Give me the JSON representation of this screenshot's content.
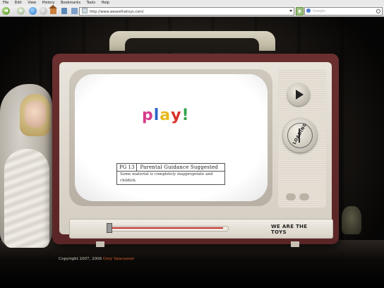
{
  "browser": {
    "menu": [
      "File",
      "Edit",
      "View",
      "History",
      "Bookmarks",
      "Tools",
      "Help"
    ],
    "url": "http://www.wearethetoys.com/",
    "search_placeholder": "Google",
    "icons": [
      "back-icon",
      "forward-icon",
      "reload-icon",
      "stop-icon",
      "home-icon"
    ]
  },
  "tv": {
    "play_letters": [
      "p",
      "l",
      "a",
      "y",
      "!"
    ],
    "play_colors": [
      "#d83b8a",
      "#2e63c9",
      "#e6b81e",
      "#d93027",
      "#2fa24a"
    ],
    "rating": {
      "code": "PG 13",
      "label": "Parental Guidance Suggested",
      "note": "Some material is completely inappropriate and childish."
    },
    "dial_label": "LOADING",
    "brand": "WE ARE THE TOYS"
  },
  "footer": {
    "copyright": "Copyright 2007, 2008",
    "author": "Grey Vancouver"
  },
  "colors": {
    "tv_body": "#6a2f2e",
    "tuner_line": "#c3302a",
    "link": "#e0642a"
  }
}
